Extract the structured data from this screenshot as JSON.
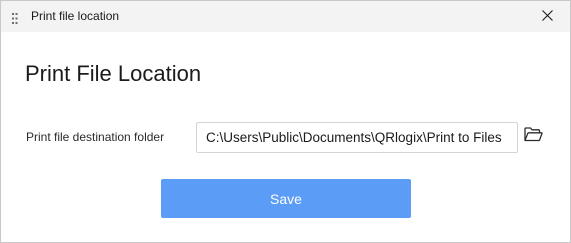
{
  "window": {
    "title": "Print file location",
    "icon": "app-grid-icon",
    "close_icon": "close-icon"
  },
  "page": {
    "heading": "Print File Location"
  },
  "form": {
    "destination_label": "Print file destination folder",
    "destination_value": "C:\\Users\\Public\\Documents\\QRlogix\\Print to Files",
    "browse_icon": "folder-open-icon",
    "save_label": "Save"
  },
  "colors": {
    "accent": "#5b9cf7",
    "titlebar": "#f3f3f3"
  }
}
